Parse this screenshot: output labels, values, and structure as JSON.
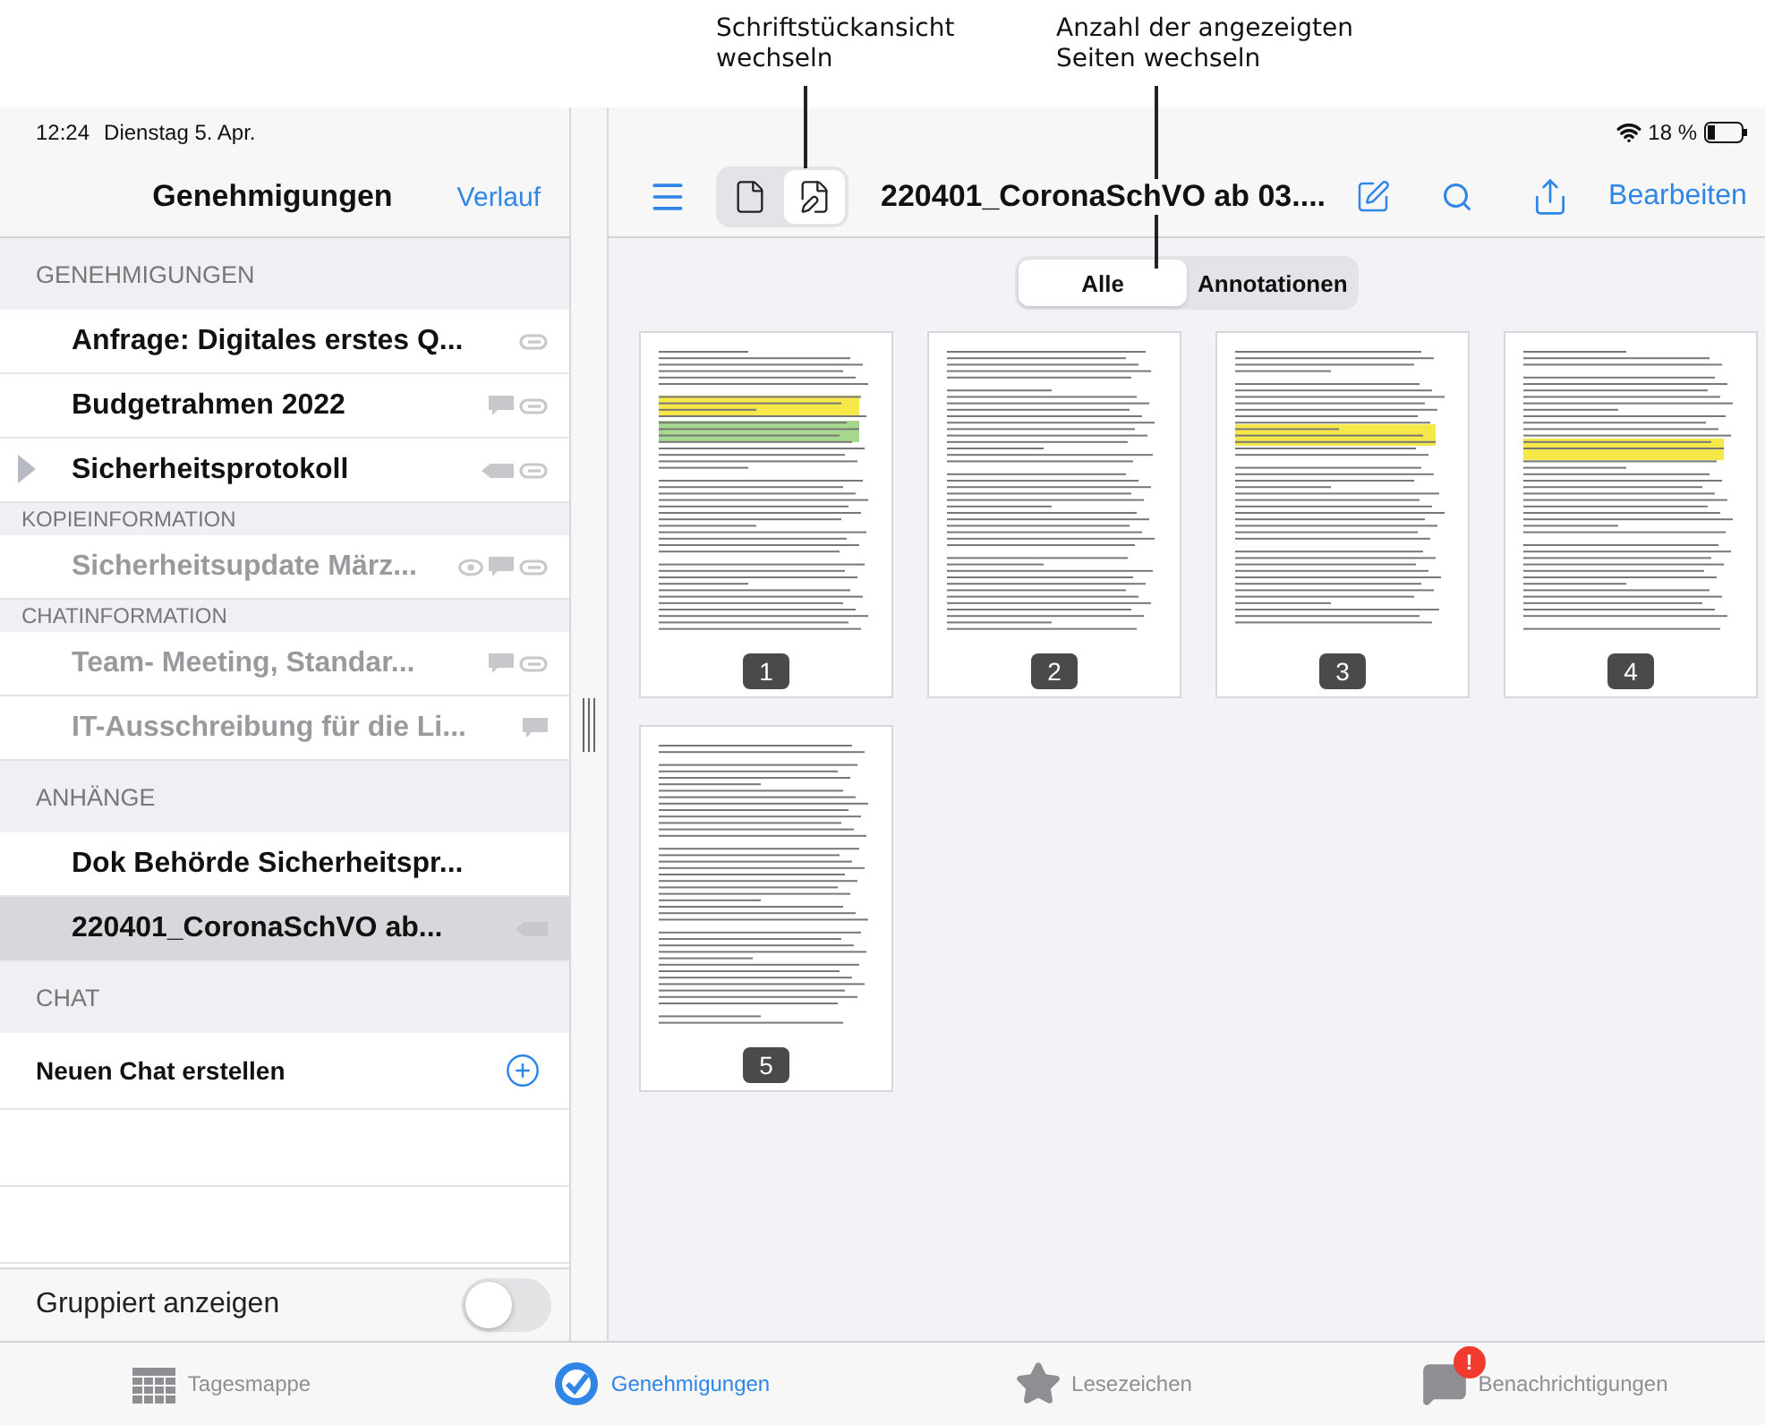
{
  "callouts": [
    {
      "lines": [
        "Schriftstückansicht",
        "wechseln"
      ]
    },
    {
      "lines": [
        "Anzahl der angezeigten",
        "Seiten wechseln"
      ]
    }
  ],
  "status_bar": {
    "time": "12:24",
    "date": "Dienstag 5. Apr.",
    "battery": "18 %"
  },
  "sidebar": {
    "title": "Genehmigungen",
    "action": "Verlauf",
    "sections": [
      {
        "header": "GENEHMIGUNGEN",
        "compact": false,
        "items": [
          {
            "title": "Anfrage: Digitales erstes Q...",
            "dimmed": false,
            "selected": false,
            "current": false,
            "attachment": true
          },
          {
            "title": "Budgetrahmen 2022",
            "dimmed": false,
            "selected": false,
            "current": false,
            "comment": true,
            "attachment": true
          },
          {
            "title": "Sicherheitsprotokoll",
            "dimmed": false,
            "selected": false,
            "current": true,
            "tagged": true,
            "attachment": true
          }
        ]
      },
      {
        "header": "KOPIEINFORMATION",
        "compact": true,
        "items": [
          {
            "title": "Sicherheitsupdate März...",
            "dimmed": true,
            "selected": false,
            "current": false,
            "seen": true,
            "comment": true,
            "attachment": true
          }
        ]
      },
      {
        "header": "CHATINFORMATION",
        "compact": true,
        "items": [
          {
            "title": "Team- Meeting, Standar...",
            "dimmed": true,
            "selected": false,
            "current": false,
            "comment": true,
            "attachment": true
          },
          {
            "title": "IT-Ausschreibung für die Li...",
            "dimmed": true,
            "selected": false,
            "current": false,
            "comment": true
          }
        ]
      },
      {
        "header": "ANHÄNGE",
        "compact": false,
        "items": [
          {
            "title": "Dok Behörde Sicherheitspr...",
            "dimmed": false,
            "selected": false,
            "current": false
          },
          {
            "title": "220401_CoronaSchVO ab...",
            "dimmed": false,
            "selected": true,
            "current": false,
            "tagged": true
          }
        ]
      },
      {
        "header": "CHAT",
        "compact": false
      }
    ],
    "new_chat": "Neuen Chat erstellen",
    "group_toggle": {
      "label": "Gruppiert anzeigen",
      "on": false
    }
  },
  "toolbar": {
    "view_modes": [
      {
        "kind": "page",
        "selected": false
      },
      {
        "kind": "annotate",
        "selected": true
      }
    ],
    "title": "220401_CoronaSchVO ab 03....",
    "action": "Bearbeiten"
  },
  "filter": [
    {
      "label": "Alle",
      "selected": true
    },
    {
      "label": "Annotationen",
      "selected": false
    }
  ],
  "pages": [
    {
      "number": "1",
      "highlights": [
        {
          "color": "#f7e84a"
        },
        {
          "color": "#a6d88e"
        }
      ]
    },
    {
      "number": "2"
    },
    {
      "number": "3",
      "highlights": [
        {
          "color": "#f7e84a"
        }
      ]
    },
    {
      "number": "4",
      "highlights": [
        {
          "color": "#f7e84a"
        }
      ]
    },
    {
      "number": "5"
    }
  ],
  "tab_bar": [
    {
      "label": "Tagesmappe",
      "kind": "calendar",
      "selected": false
    },
    {
      "label": "Genehmigungen",
      "kind": "approvals",
      "selected": true
    },
    {
      "label": "Lesezeichen",
      "kind": "star",
      "selected": false
    },
    {
      "label": "Benachrichtigungen",
      "kind": "messages",
      "selected": false,
      "badge": "!"
    }
  ]
}
